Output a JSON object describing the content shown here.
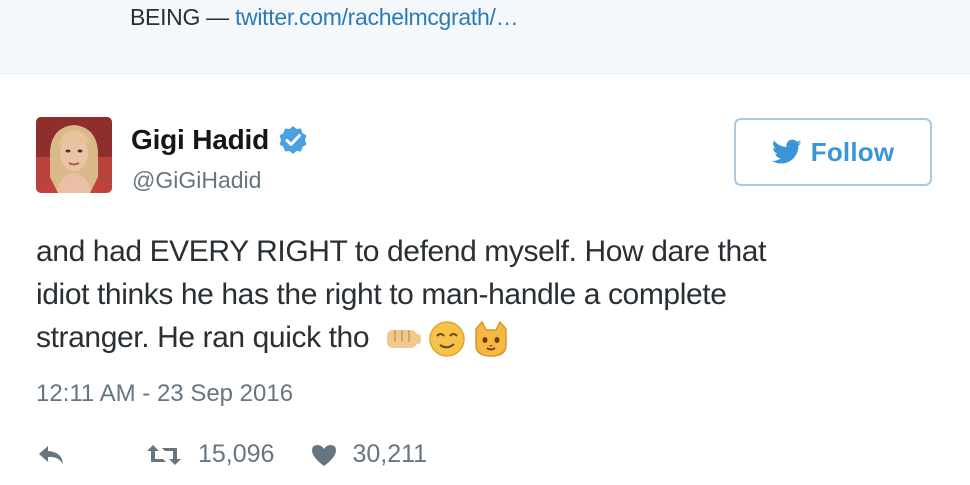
{
  "quoted": {
    "prefix": "BEING — ",
    "link": "twitter.com/rachelmcgrath/…"
  },
  "tweet": {
    "display_name": "Gigi Hadid",
    "handle": "@GiGiHadid",
    "follow_label": "Follow",
    "text_line_1": "and had EVERY RIGHT to defend myself. How dare that",
    "text_line_2": "idiot thinks he has the right to man-handle a complete",
    "text_line_3": "stranger. He ran quick tho",
    "emojis": [
      "fist-emoji",
      "relieved-face-emoji",
      "cat-face-emoji"
    ],
    "timestamp": "12:11 AM - 23 Sep 2016",
    "retweet_count": "15,096",
    "like_count": "30,211"
  },
  "colors": {
    "link": "#2b7bb9",
    "follow": "#3a95d7",
    "verified": "#4aa0e0",
    "muted": "#66757f"
  }
}
